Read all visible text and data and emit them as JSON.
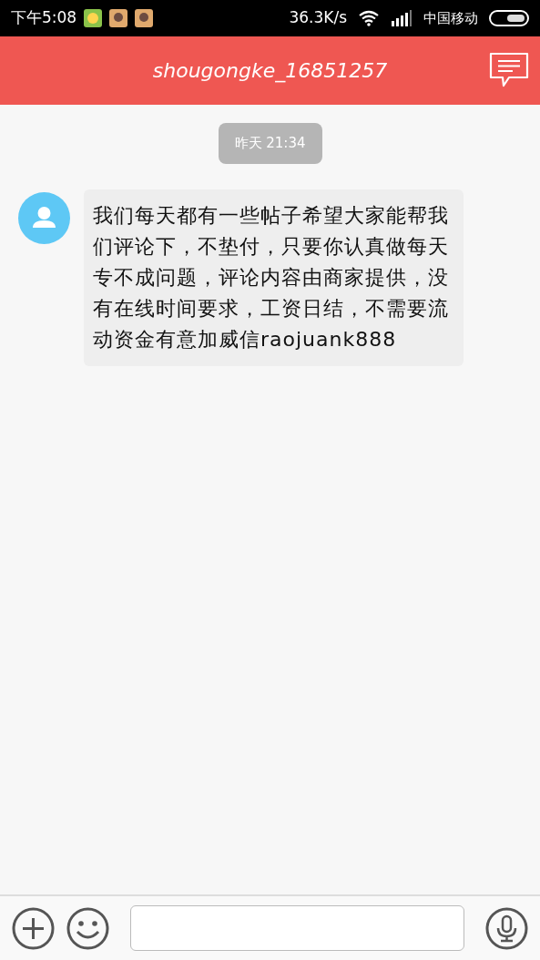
{
  "status_bar": {
    "time": "下午5:08",
    "speed": "36.3K/s",
    "carrier": "中国移动"
  },
  "header": {
    "title": "shougongke_16851257"
  },
  "messages": [
    {
      "kind": "timestamp",
      "text": "昨天 21:34"
    },
    {
      "kind": "incoming",
      "text": "我们每天都有一些帖子希望大家能帮我们评论下，不垫付，只要你认真做每天专不成问题，评论内容由商家提供，没有在线时间要求，工资日结，不需要流动资金有意加威信raojuank888"
    }
  ]
}
